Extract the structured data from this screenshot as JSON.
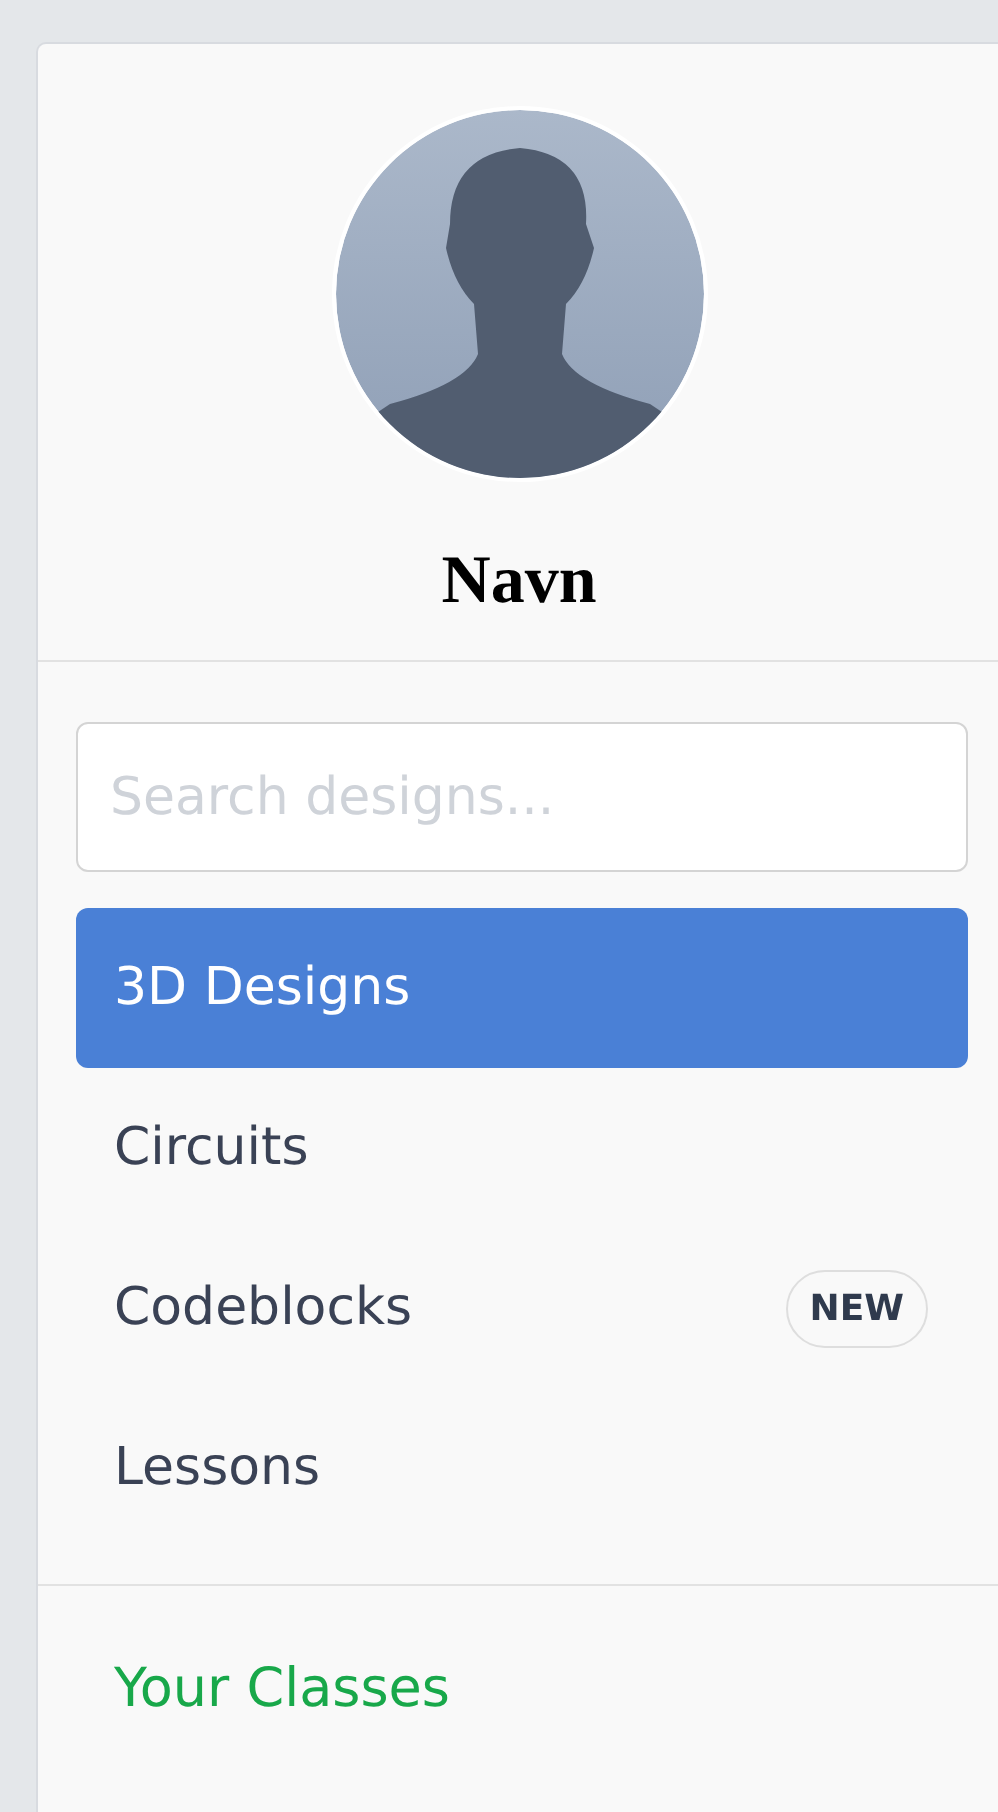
{
  "profile": {
    "name": "Navn"
  },
  "search": {
    "placeholder": "Search designs..."
  },
  "nav_items": [
    {
      "label": "3D Designs",
      "selected": true
    },
    {
      "label": "Circuits",
      "selected": false
    },
    {
      "label": "Codeblocks",
      "selected": false,
      "badge": "NEW"
    },
    {
      "label": "Lessons",
      "selected": false
    }
  ],
  "classes_link": "Your Classes"
}
